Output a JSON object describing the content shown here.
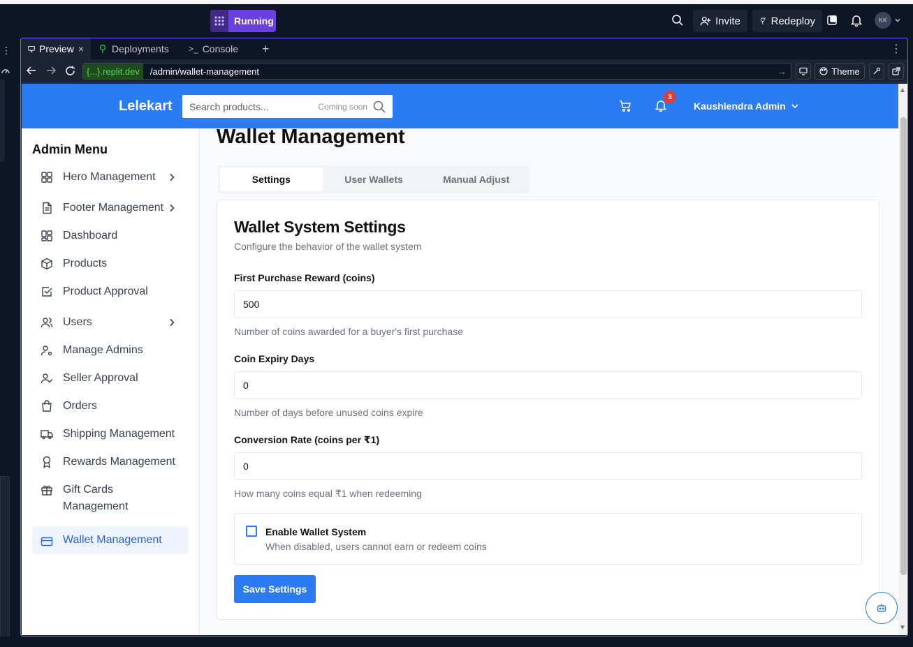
{
  "replit": {
    "status": "Running",
    "invite": "Invite",
    "redeploy": "Redeploy",
    "avatar": "KK",
    "tabs": [
      {
        "label": "Preview"
      },
      {
        "label": "Deployments"
      },
      {
        "label": "Console"
      }
    ],
    "url_host": "{...}.replit.dev",
    "url_path": "/admin/wallet-management",
    "theme": "Theme"
  },
  "app": {
    "brand": "Lelekart",
    "search_placeholder": "Search products...",
    "search_hint": "Coming soon",
    "notif_count": "3",
    "admin_name": "Kaushlendra Admin",
    "sidebar_title": "Admin Menu",
    "menu": [
      {
        "label": "Hero Management",
        "icon": "grid-icon",
        "chevron": true
      },
      {
        "label": "Footer Management",
        "icon": "file-text-icon",
        "chevron": true
      },
      {
        "label": "Dashboard",
        "icon": "layout-dashboard-icon",
        "chevron": false
      },
      {
        "label": "Products",
        "icon": "package-icon",
        "chevron": false
      },
      {
        "label": "Product Approval",
        "icon": "check-square-icon",
        "chevron": false
      },
      {
        "label": "Users",
        "icon": "users-icon",
        "chevron": true
      },
      {
        "label": "Manage Admins",
        "icon": "user-cog-icon",
        "chevron": false
      },
      {
        "label": "Seller Approval",
        "icon": "user-check-icon",
        "chevron": false
      },
      {
        "label": "Orders",
        "icon": "shopping-bag-icon",
        "chevron": false
      },
      {
        "label": "Shipping Management",
        "icon": "truck-icon",
        "chevron": false
      },
      {
        "label": "Rewards Management",
        "icon": "award-icon",
        "chevron": false
      },
      {
        "label": "Gift Cards Management",
        "icon": "gift-icon",
        "chevron": false
      },
      {
        "label": "Wallet Management",
        "icon": "credit-card-icon",
        "chevron": false,
        "active": true
      }
    ],
    "page_title": "Wallet Management",
    "page_tabs": [
      "Settings",
      "User Wallets",
      "Manual Adjust"
    ],
    "card": {
      "title": "Wallet System Settings",
      "subtitle": "Configure the behavior of the wallet system",
      "fields": [
        {
          "label": "First Purchase Reward (coins)",
          "value": "500",
          "help": "Number of coins awarded for a buyer's first purchase"
        },
        {
          "label": "Coin Expiry Days",
          "value": "0",
          "help": "Number of days before unused coins expire"
        },
        {
          "label": "Conversion Rate (coins per ₹1)",
          "value": "0",
          "help": "How many coins equal ₹1 when redeeming"
        }
      ],
      "enable_label": "Enable Wallet System",
      "enable_help": "When disabled, users cannot earn or redeem coins",
      "enable_checked": false,
      "save_label": "Save Settings"
    }
  },
  "colors": {
    "replit_bg": "#0e1525",
    "brand_blue": "#2b7bf3",
    "badge_red": "#e53935",
    "running_purple": "#6c3fe0"
  }
}
